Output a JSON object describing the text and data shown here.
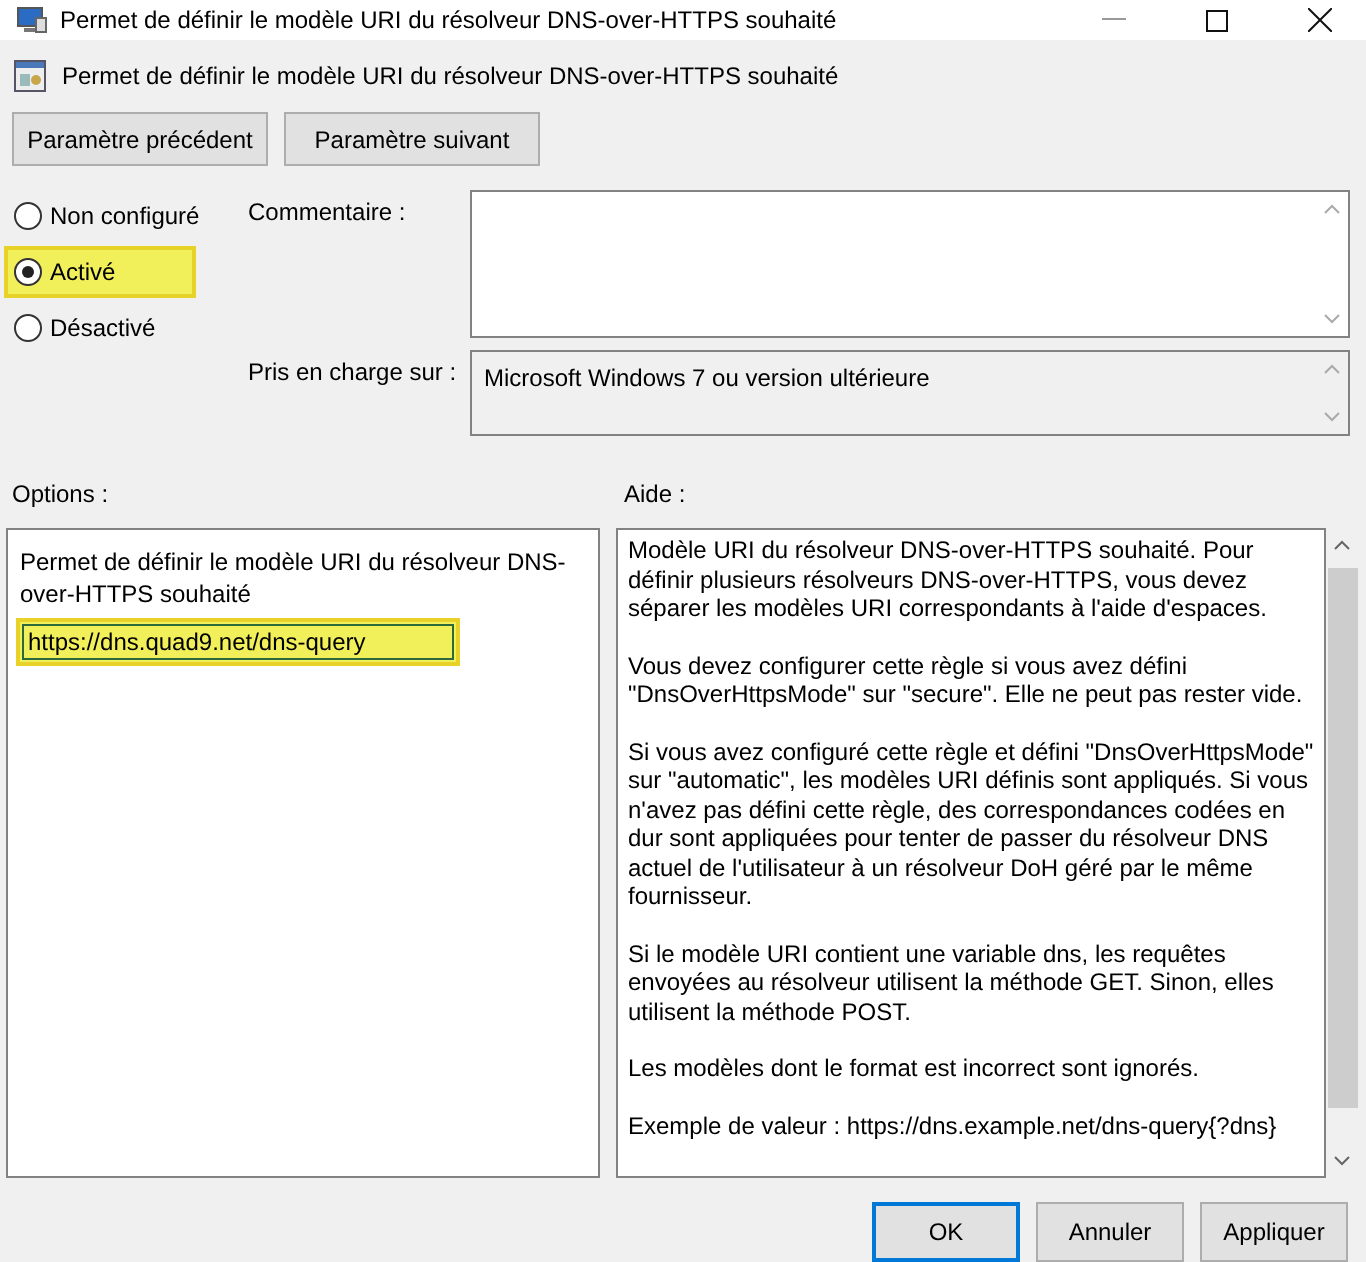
{
  "window": {
    "title": "Permet de définir le modèle URI du résolveur DNS-over-HTTPS souhaité"
  },
  "header": {
    "title": "Permet de définir le modèle URI du résolveur DNS-over-HTTPS souhaité"
  },
  "nav_buttons": [
    "Paramètre précédent",
    "Paramètre suivant"
  ],
  "states": [
    {
      "label": "Non configuré",
      "selected": false,
      "highlighted": false
    },
    {
      "label": "Activé",
      "selected": true,
      "highlighted": true
    },
    {
      "label": "Désactivé",
      "selected": false,
      "highlighted": false
    }
  ],
  "comment": {
    "label": "Commentaire :"
  },
  "supported": {
    "label": "Pris en charge sur :",
    "value": "Microsoft Windows 7 ou version ultérieure"
  },
  "options": {
    "label": "Options :",
    "description": "Permet de définir le modèle URI du résolveur DNS-over-HTTPS souhaité",
    "field": {
      "value": "https://dns.quad9.net/dns-query",
      "highlighted": true
    }
  },
  "help": {
    "label": "Aide :",
    "paragraphs": [
      "Modèle URI du résolveur DNS-over-HTTPS souhaité. Pour définir plusieurs résolveurs DNS-over-HTTPS, vous devez séparer les modèles URI correspondants à l'aide d'espaces.",
      "Vous devez configurer cette règle si vous avez défini \"DnsOverHttpsMode\" sur \"secure\". Elle ne peut pas rester vide.",
      "Si vous avez configuré cette règle et défini \"DnsOverHttpsMode\" sur \"automatic\", les modèles URI définis sont appliqués. Si vous n'avez pas défini cette règle, des correspondances codées en dur sont appliquées pour tenter de passer du résolveur DNS actuel de l'utilisateur à un résolveur DoH géré par le même fournisseur.",
      "Si le modèle URI contient une variable dns, les requêtes envoyées au résolveur utilisent la méthode GET. Sinon, elles utilisent la méthode POST.",
      "Les modèles dont le format est incorrect sont ignorés.",
      "Exemple de valeur : https://dns.example.net/dns-query{?dns}"
    ]
  },
  "footer_buttons": [
    {
      "label": "OK",
      "selected": true
    },
    {
      "label": "Annuler",
      "selected": false
    },
    {
      "label": "Appliquer",
      "selected": false
    }
  ]
}
